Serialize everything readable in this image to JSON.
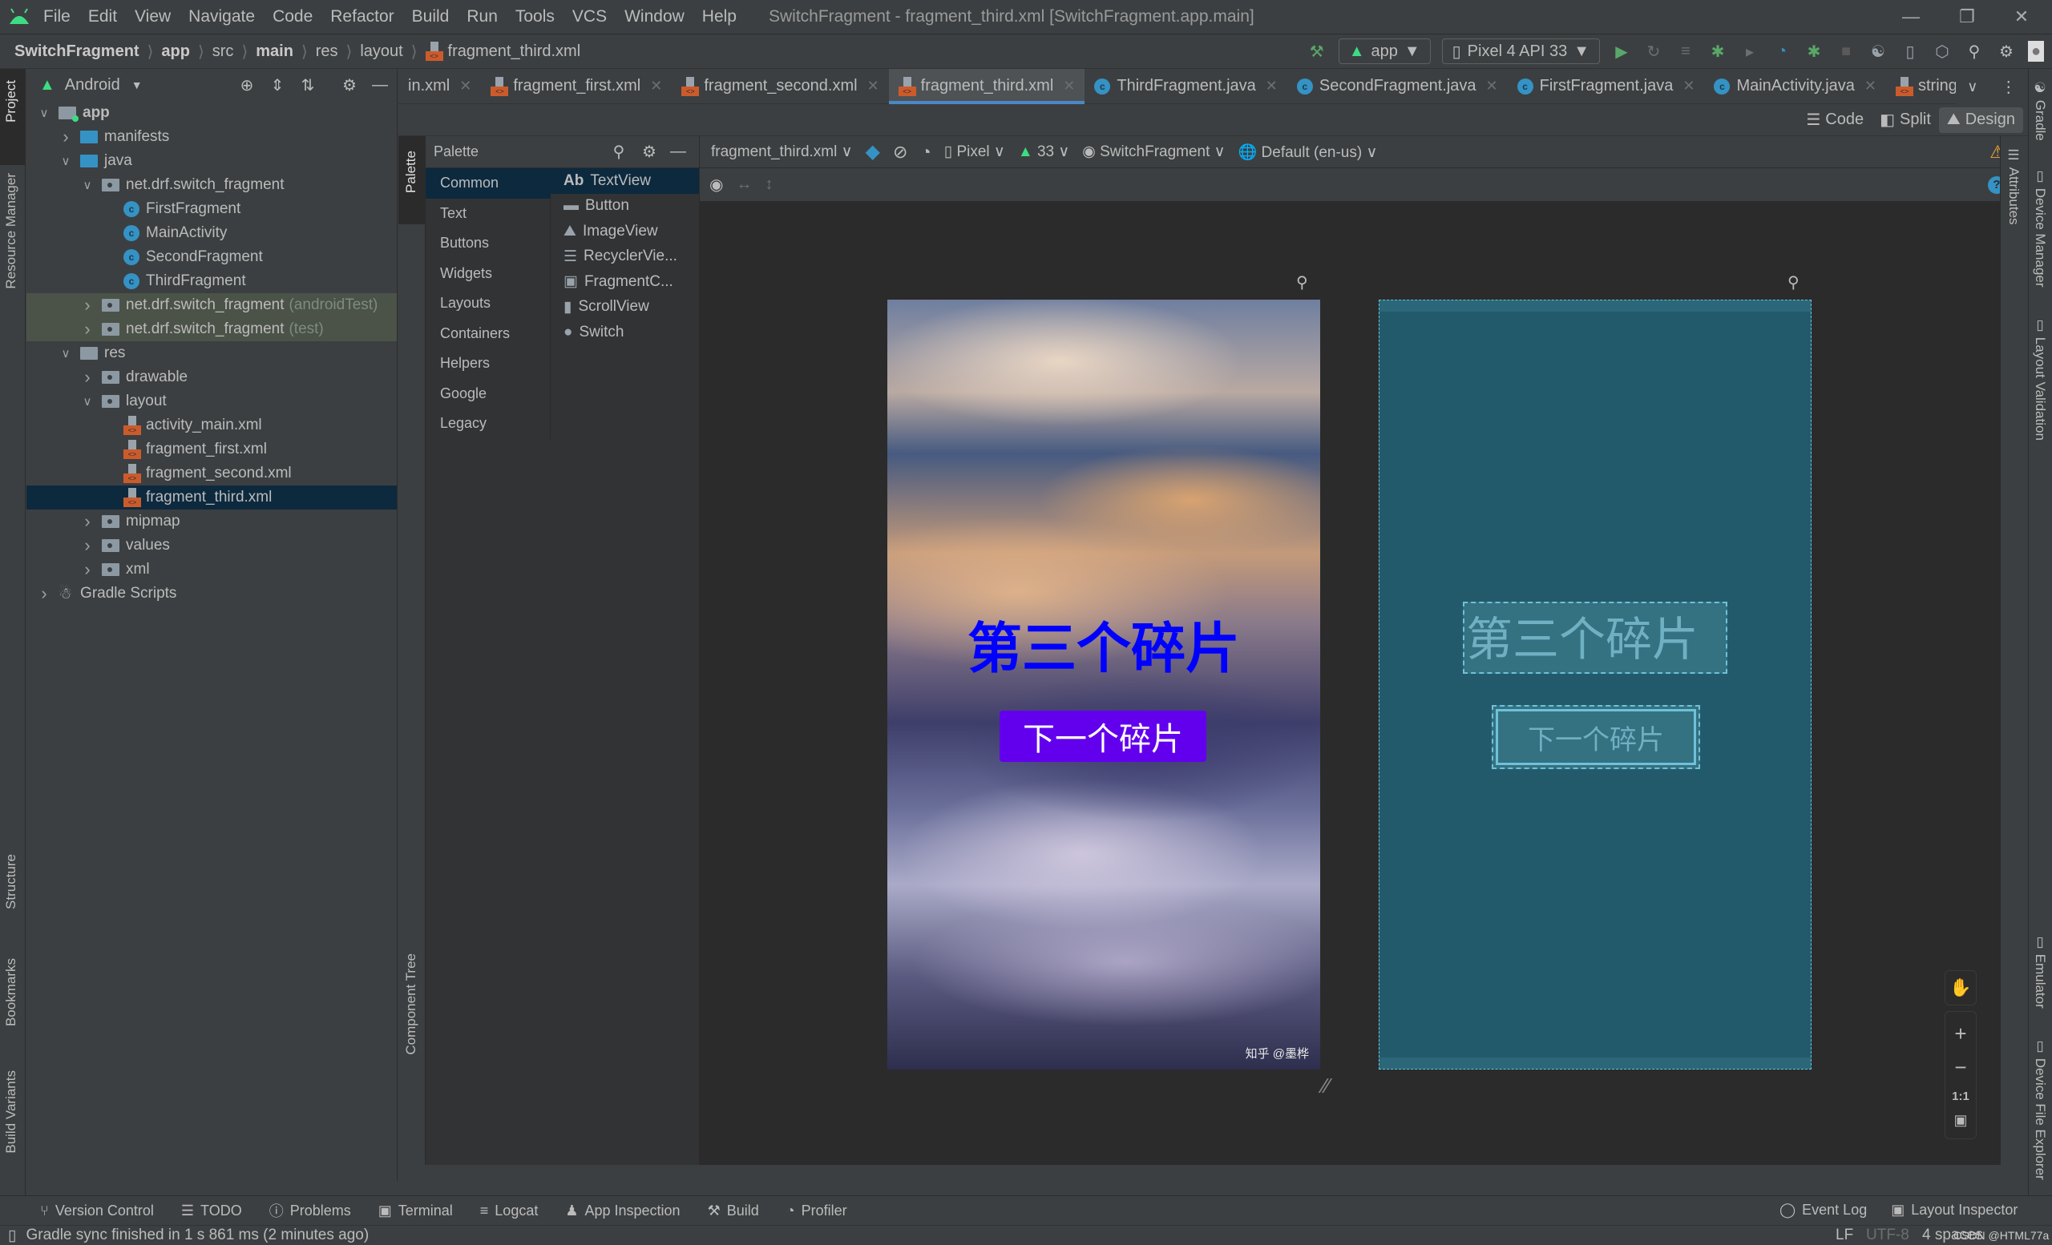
{
  "menubar": {
    "items": [
      "File",
      "Edit",
      "View",
      "Navigate",
      "Code",
      "Refactor",
      "Build",
      "Run",
      "Tools",
      "VCS",
      "Window",
      "Help"
    ],
    "window_title": "SwitchFragment - fragment_third.xml [SwitchFragment.app.main]"
  },
  "breadcrumb": [
    "SwitchFragment",
    "app",
    "src",
    "main",
    "res",
    "layout",
    "fragment_third.xml"
  ],
  "toolbar": {
    "run_config": "app",
    "device": "Pixel 4 API 33"
  },
  "project_panel": {
    "view_mode": "Android",
    "tree": [
      {
        "label": "app",
        "level": 0,
        "expanded": true,
        "type": "module"
      },
      {
        "label": "manifests",
        "level": 1,
        "expanded": false,
        "type": "folder-blue"
      },
      {
        "label": "java",
        "level": 1,
        "expanded": true,
        "type": "folder-blue"
      },
      {
        "label": "net.drf.switch_fragment",
        "level": 2,
        "expanded": true,
        "type": "package"
      },
      {
        "label": "FirstFragment",
        "level": 3,
        "type": "class"
      },
      {
        "label": "MainActivity",
        "level": 3,
        "type": "class"
      },
      {
        "label": "SecondFragment",
        "level": 3,
        "type": "class"
      },
      {
        "label": "ThirdFragment",
        "level": 3,
        "type": "class"
      },
      {
        "label": "net.drf.switch_fragment",
        "suffix": "(androidTest)",
        "level": 2,
        "expanded": false,
        "type": "package",
        "highlight": true
      },
      {
        "label": "net.drf.switch_fragment",
        "suffix": "(test)",
        "level": 2,
        "expanded": false,
        "type": "package",
        "highlight": true
      },
      {
        "label": "res",
        "level": 1,
        "expanded": true,
        "type": "res"
      },
      {
        "label": "drawable",
        "level": 2,
        "expanded": false,
        "type": "package"
      },
      {
        "label": "layout",
        "level": 2,
        "expanded": true,
        "type": "package"
      },
      {
        "label": "activity_main.xml",
        "level": 3,
        "type": "xml"
      },
      {
        "label": "fragment_first.xml",
        "level": 3,
        "type": "xml"
      },
      {
        "label": "fragment_second.xml",
        "level": 3,
        "type": "xml"
      },
      {
        "label": "fragment_third.xml",
        "level": 3,
        "type": "xml",
        "selected": true
      },
      {
        "label": "mipmap",
        "level": 2,
        "expanded": false,
        "type": "package"
      },
      {
        "label": "values",
        "level": 2,
        "expanded": false,
        "type": "package"
      },
      {
        "label": "xml",
        "level": 2,
        "expanded": false,
        "type": "package"
      },
      {
        "label": "Gradle Scripts",
        "level": 0,
        "expanded": false,
        "type": "gradle"
      }
    ]
  },
  "left_strip": {
    "project": "Project",
    "resource_manager": "Resource Manager",
    "structure": "Structure",
    "bookmarks": "Bookmarks",
    "build_variants": "Build Variants"
  },
  "editor_tabs": [
    {
      "label": "in.xml",
      "type": "xml"
    },
    {
      "label": "fragment_first.xml",
      "type": "xml"
    },
    {
      "label": "fragment_second.xml",
      "type": "xml"
    },
    {
      "label": "fragment_third.xml",
      "type": "xml",
      "active": true
    },
    {
      "label": "ThirdFragment.java",
      "type": "class"
    },
    {
      "label": "SecondFragment.java",
      "type": "class"
    },
    {
      "label": "FirstFragment.java",
      "type": "class"
    },
    {
      "label": "MainActivity.java",
      "type": "class"
    },
    {
      "label": "strings.xml",
      "type": "xml"
    }
  ],
  "view_modes": {
    "code": "Code",
    "split": "Split",
    "design": "Design",
    "active": "Design"
  },
  "palette": {
    "title": "Palette",
    "tab_label": "Palette",
    "categories": [
      "Common",
      "Text",
      "Buttons",
      "Widgets",
      "Layouts",
      "Containers",
      "Helpers",
      "Google",
      "Legacy"
    ],
    "selected_category": "Common",
    "components": [
      "TextView",
      "Button",
      "ImageView",
      "RecyclerVie...",
      "FragmentC...",
      "ScrollView",
      "Switch"
    ],
    "textview_prefix": "Ab",
    "component_tree_label": "Component Tree"
  },
  "design_toolbar": {
    "file": "fragment_third.xml",
    "device": "Pixel",
    "api": "33",
    "theme": "SwitchFragment",
    "locale": "Default (en-us)"
  },
  "preview": {
    "title_text": "第三个碎片",
    "button_text": "下一个碎片",
    "watermark": "知乎 @墨桦",
    "title_color": "#0000ff",
    "button_color": "#6200ee"
  },
  "zoom_controls": {
    "one_to_one": "1:1"
  },
  "right_strip": {
    "gradle": "Gradle",
    "device_manager": "Device Manager",
    "layout_validation": "Layout Validation",
    "emulator": "Emulator",
    "device_file_explorer": "Device File Explorer",
    "attributes": "Attributes"
  },
  "bottom_tools": [
    {
      "label": "Version Control",
      "icon": "branch-icon"
    },
    {
      "label": "TODO",
      "icon": "list-icon"
    },
    {
      "label": "Problems",
      "icon": "problems-icon"
    },
    {
      "label": "Terminal",
      "icon": "terminal-icon"
    },
    {
      "label": "Logcat",
      "icon": "logcat-icon"
    },
    {
      "label": "App Inspection",
      "icon": "inspection-icon"
    },
    {
      "label": "Build",
      "icon": "hammer-icon"
    },
    {
      "label": "Profiler",
      "icon": "profiler-icon"
    }
  ],
  "bottom_right_tools": {
    "event_log": "Event Log",
    "layout_inspector": "Layout Inspector"
  },
  "status": {
    "message": "Gradle sync finished in 1 s 861 ms (2 minutes ago)",
    "line_ending": "LF",
    "encoding": "UTF-8",
    "indent": "4 spaces",
    "overlay": "CSDN @HTML77a"
  }
}
